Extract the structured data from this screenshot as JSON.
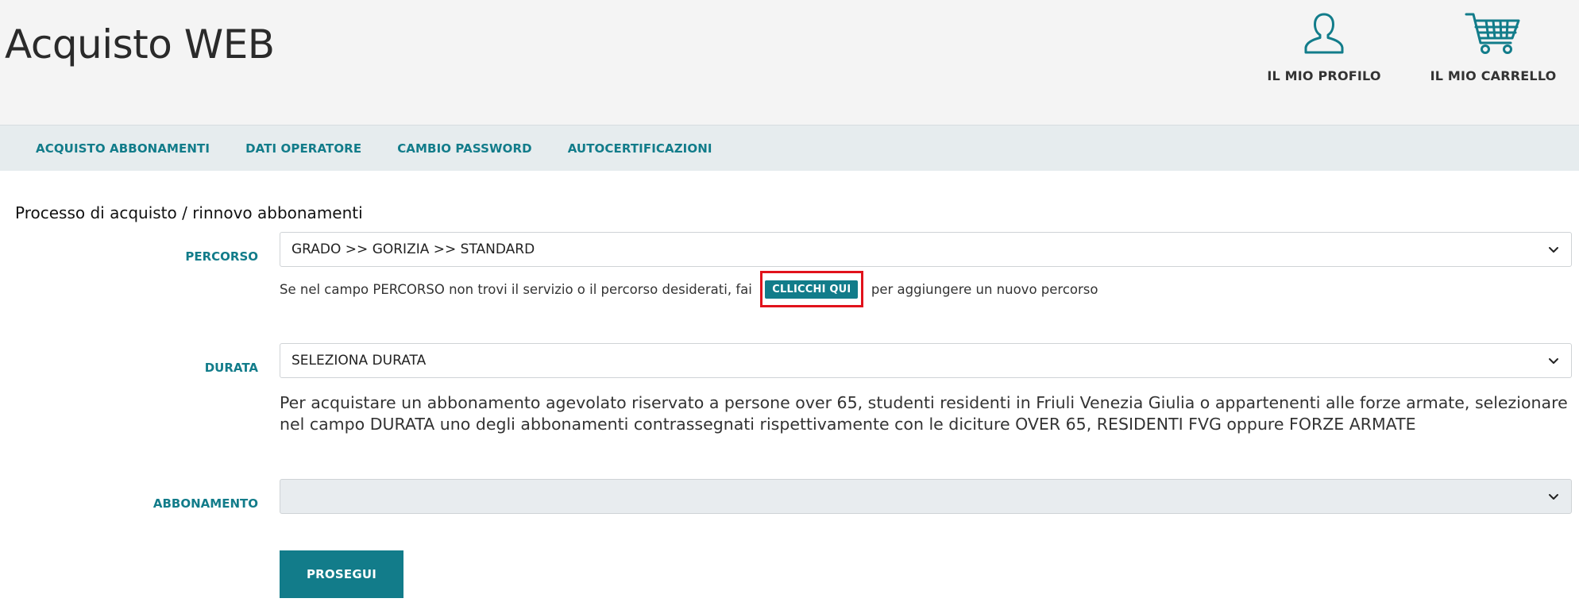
{
  "header": {
    "title": "Acquisto WEB",
    "profile_label": "IL MIO PROFILO",
    "cart_label": "IL MIO CARRELLO",
    "accent_color": "#127c8a",
    "icons": {
      "profile": "user-icon",
      "cart": "shopping-cart-icon"
    }
  },
  "nav": {
    "items": [
      {
        "label": "ACQUISTO ABBONAMENTI"
      },
      {
        "label": "DATI OPERATORE"
      },
      {
        "label": "CAMBIO PASSWORD"
      },
      {
        "label": "AUTOCERTIFICAZIONI"
      }
    ]
  },
  "form": {
    "title": "Processo di acquisto / rinnovo abbonamenti",
    "percorso": {
      "label": "PERCORSO",
      "value": "GRADO >> GORIZIA >> STANDARD",
      "hint_before": "Se nel campo PERCORSO non trovi il servizio o il percorso desiderati, fai",
      "hint_button": "CLLICCHI QUI",
      "hint_after": "per aggiungere un nuovo percorso"
    },
    "durata": {
      "label": "DURATA",
      "value": "SELEZIONA DURATA",
      "info": "Per acquistare un abbonamento agevolato riservato a persone over 65, studenti residenti in Friuli Venezia Giulia o appartenenti alle forze armate, selezionare nel campo DURATA uno degli abbonamenti contrassegnati rispettivamente con le diciture OVER 65, RESIDENTI FVG oppure FORZE ARMATE"
    },
    "abbonamento": {
      "label": "ABBONAMENTO",
      "value": ""
    },
    "submit_label": "PROSEGUI"
  }
}
